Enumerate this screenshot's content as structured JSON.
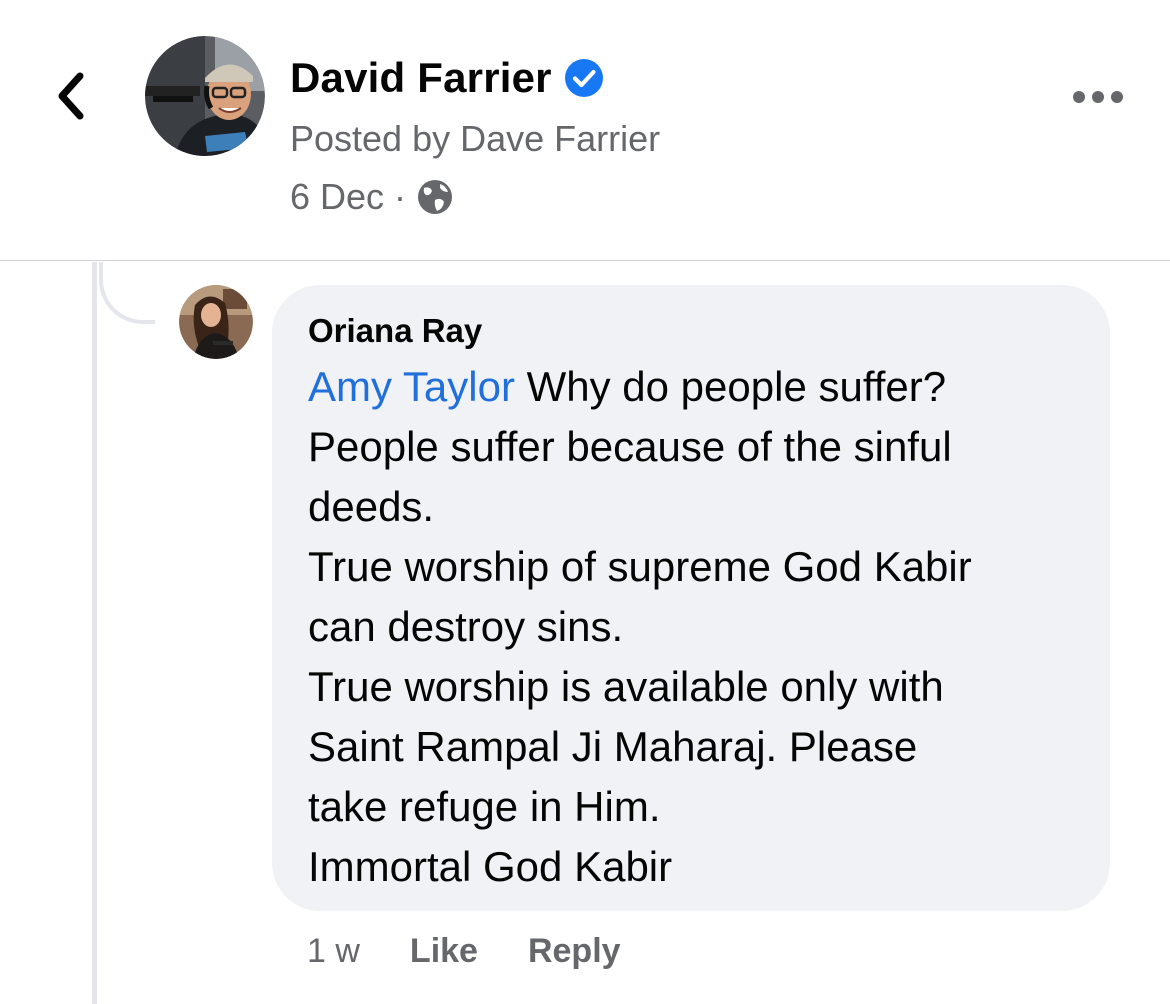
{
  "header": {
    "author_name": "David Farrier",
    "posted_by": "Posted by Dave Farrier",
    "date": "6 Dec",
    "separator": "·",
    "icons": {
      "back": "chevron-left-icon",
      "verified": "verified-badge-icon",
      "privacy": "globe-icon",
      "more": "more-horizontal-icon"
    }
  },
  "comment": {
    "author": "Oriana Ray",
    "mention": "Amy Taylor",
    "lines": [
      " Why do people suffer?",
      "People suffer because of the sinful",
      "deeds.",
      "True worship of supreme God Kabir",
      "can destroy sins.",
      "True worship is available only with",
      "Saint Rampal Ji Maharaj. Please",
      "take refuge in Him.",
      "Immortal God Kabir"
    ],
    "time": "1 w",
    "like_label": "Like",
    "reply_label": "Reply"
  },
  "colors": {
    "text_primary": "#050505",
    "text_secondary": "#65676b",
    "mention": "#216fdb",
    "verified": "#1877f2",
    "bubble": "#f0f2f5",
    "thread_line": "#e4e6eb"
  }
}
